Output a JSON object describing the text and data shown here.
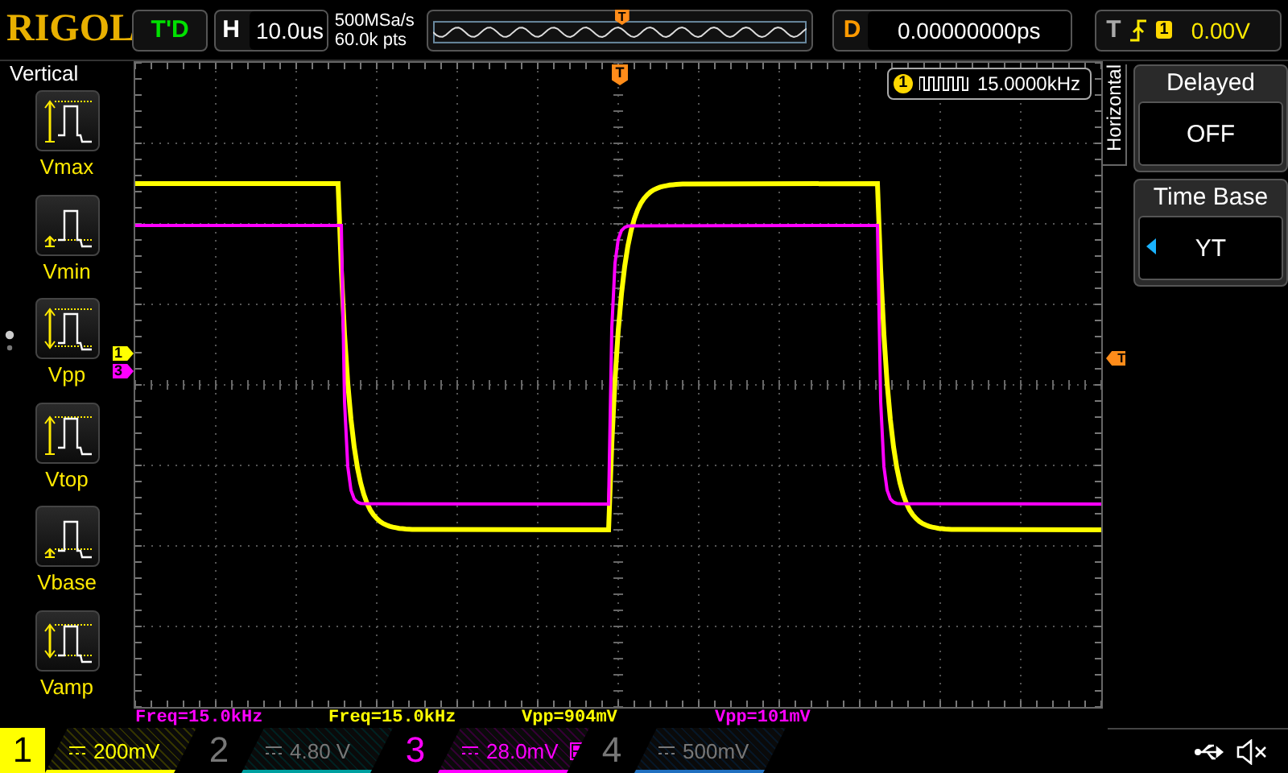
{
  "logo": "RIGOL",
  "run_status": "T'D",
  "horizontal": {
    "label": "H",
    "timebase": "10.0us",
    "sample_rate": "500MSa/s",
    "memory_depth": "60.0k pts",
    "trigger_marker": "T"
  },
  "delay": {
    "label": "D",
    "value": "0.00000000ps"
  },
  "trigger": {
    "label": "T",
    "source": "1",
    "level": "0.00V"
  },
  "sidebar": {
    "title": "Vertical",
    "items": [
      {
        "label": "Vmax",
        "kind": "vmax"
      },
      {
        "label": "Vmin",
        "kind": "vmin"
      },
      {
        "label": "Vpp",
        "kind": "vpp"
      },
      {
        "label": "Vtop",
        "kind": "vtop"
      },
      {
        "label": "Vbase",
        "kind": "vbase"
      },
      {
        "label": "Vamp",
        "kind": "vamp"
      }
    ]
  },
  "screen": {
    "trigger_position_marker": "T",
    "trigger_level_marker": "T",
    "channel_markers": [
      {
        "label": "1",
        "color": "#ffff00"
      },
      {
        "label": "3",
        "color": "#ff00ff"
      }
    ],
    "frequency_counter": {
      "channel": "1",
      "value": "15.0000kHz"
    }
  },
  "menu": {
    "title": "Horizontal",
    "items": [
      {
        "title": "Delayed",
        "value": "OFF",
        "selectable": false
      },
      {
        "title": "Time Base",
        "value": "YT",
        "selectable": true
      }
    ]
  },
  "measurements": [
    {
      "text": "Freq=15.0kHz",
      "color": "#ff00ff"
    },
    {
      "text": "Freq=15.0kHz",
      "color": "#ffff00"
    },
    {
      "text": "Vpp=904mV",
      "color": "#ffff00"
    },
    {
      "text": "Vpp=101mV",
      "color": "#ff00ff"
    }
  ],
  "channels": [
    {
      "number": "1",
      "scale": "200mV",
      "on": true,
      "selected": true,
      "bandwidth_limit": false,
      "color": "#ffff00"
    },
    {
      "number": "2",
      "scale": "4.80 V",
      "on": false,
      "selected": false,
      "bandwidth_limit": false,
      "color": "#00a0a0"
    },
    {
      "number": "3",
      "scale": "28.0mV",
      "on": true,
      "selected": false,
      "bandwidth_limit": true,
      "color": "#ff00ff"
    },
    {
      "number": "4",
      "scale": "500mV",
      "on": false,
      "selected": false,
      "bandwidth_limit": false,
      "color": "#2070c0"
    }
  ]
}
